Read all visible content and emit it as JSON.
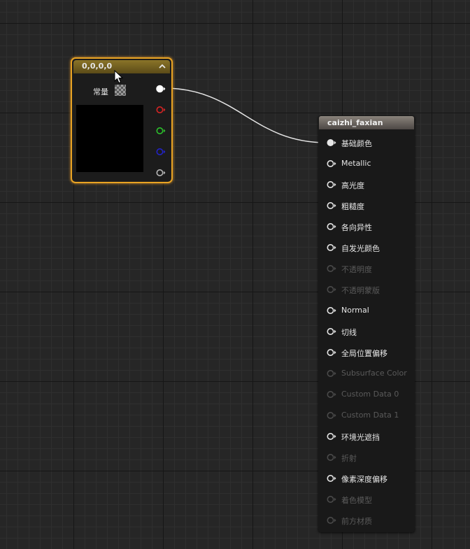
{
  "constant_node": {
    "title": "0,0,0,0",
    "param_label": "常量",
    "output_pins": [
      {
        "name": "rgba-output",
        "color": "#ffffff",
        "connected": true
      },
      {
        "name": "r-output",
        "color": "#d82424"
      },
      {
        "name": "g-output",
        "color": "#2cc22c"
      },
      {
        "name": "b-output",
        "color": "#2323c8"
      },
      {
        "name": "a-output",
        "color": "#b8b8b8"
      }
    ]
  },
  "material_node": {
    "title": "caizhi_faxian",
    "inputs": [
      {
        "label": "基础颜色",
        "enabled": true,
        "connected": true
      },
      {
        "label": "Metallic",
        "enabled": true
      },
      {
        "label": "高光度",
        "enabled": true
      },
      {
        "label": "粗糙度",
        "enabled": true
      },
      {
        "label": "各向异性",
        "enabled": true
      },
      {
        "label": "自发光颜色",
        "enabled": true
      },
      {
        "label": "不透明度",
        "enabled": false
      },
      {
        "label": "不透明蒙版",
        "enabled": false
      },
      {
        "label": "Normal",
        "enabled": true
      },
      {
        "label": "切线",
        "enabled": true
      },
      {
        "label": "全局位置偏移",
        "enabled": true
      },
      {
        "label": "Subsurface Color",
        "enabled": false
      },
      {
        "label": "Custom Data 0",
        "enabled": false
      },
      {
        "label": "Custom Data 1",
        "enabled": false
      },
      {
        "label": "环境光遮挡",
        "enabled": true
      },
      {
        "label": "折射",
        "enabled": false
      },
      {
        "label": "像素深度偏移",
        "enabled": true
      },
      {
        "label": "着色模型",
        "enabled": false
      },
      {
        "label": "前方材质",
        "enabled": false
      }
    ]
  },
  "colors": {
    "selection_outline": "#e8a323",
    "wire": "#e6e6e6",
    "disabled_text": "#5a5a5a"
  }
}
